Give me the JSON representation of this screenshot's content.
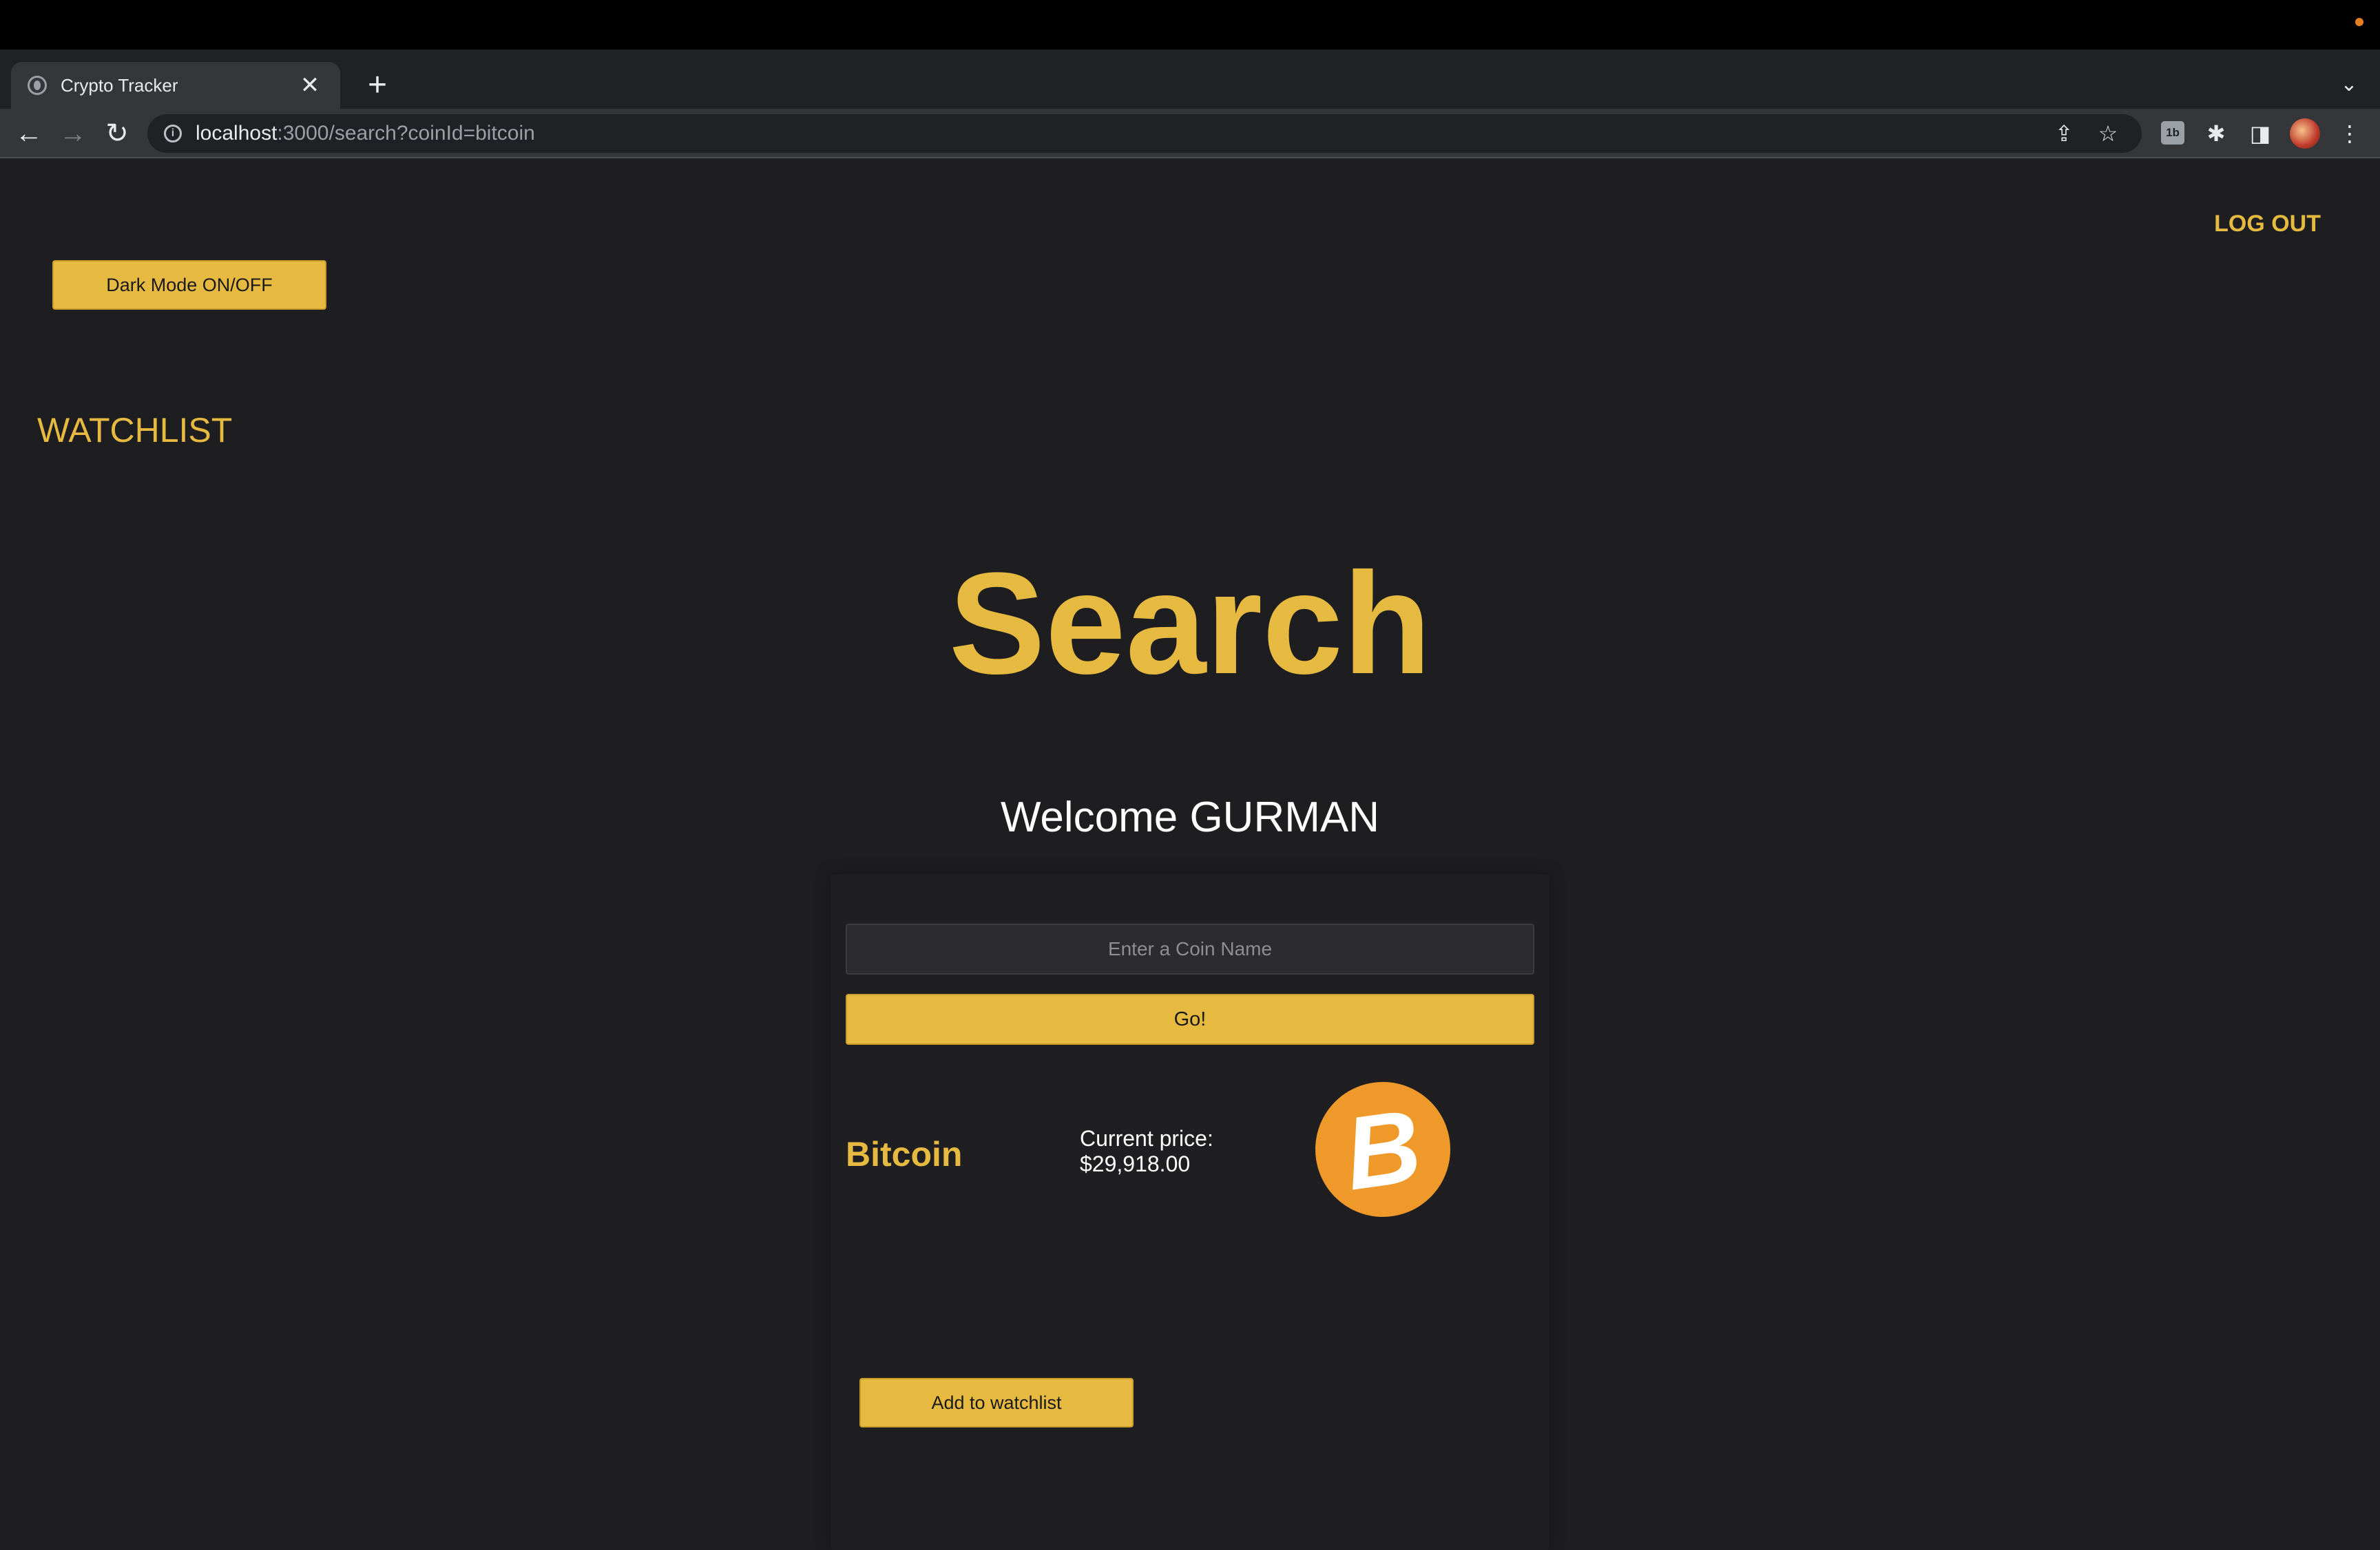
{
  "browser": {
    "tab_title": "Crypto Tracker",
    "tab_close": "✕",
    "new_tab": "+",
    "tab_menu": "⌄",
    "url_host": "localhost",
    "url_rest": ":3000/search?coinId=bitcoin",
    "back": "←",
    "forward": "→",
    "reload": "↻",
    "share_icon": "⇪",
    "star_icon": "☆",
    "ext_tile": "1b",
    "puzzle_icon": "✱",
    "sidepanel_icon": "◨",
    "menu_icon": "⋮"
  },
  "page": {
    "logout_label": "LOG OUT",
    "dark_mode_label": "Dark Mode ON/OFF",
    "watchlist_label": "WATCHLIST",
    "title": "Search",
    "welcome": "Welcome GURMAN",
    "search": {
      "placeholder": "Enter a Coin Name",
      "value": "",
      "go_label": "Go!"
    },
    "result": {
      "coin_name": "Bitcoin",
      "price_label": "Current price:",
      "price_value": "$29,918.00",
      "logo_icon": "bitcoin-logo",
      "logo_symbol": "B",
      "add_label": "Add to watchlist"
    }
  },
  "colors": {
    "accent": "#e6b941",
    "background": "#1e1e20",
    "bitcoin_orange": "#f0992b"
  }
}
